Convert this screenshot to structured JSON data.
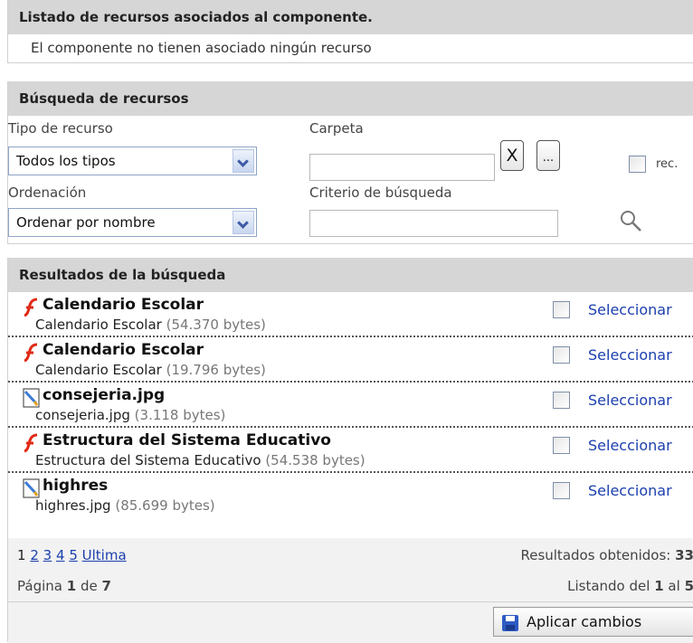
{
  "assoc": {
    "header": "Listado de recursos asociados al componente.",
    "empty_message": "El componente no tienen asociado ningún recurso"
  },
  "search": {
    "header": "Búsqueda de recursos",
    "type_label": "Tipo de recurso",
    "type_value": "Todos los tipos",
    "folder_label": "Carpeta",
    "folder_value": "",
    "clear_button": "X",
    "browse_button": "...",
    "rec_label": "rec.",
    "order_label": "Ordenación",
    "order_value": "Ordenar por nombre",
    "criteria_label": "Criterio de búsqueda",
    "criteria_value": ""
  },
  "results": {
    "header": "Resultados de la búsqueda",
    "select_label": "Seleccionar",
    "items": [
      {
        "title": "Calendario Escolar",
        "name": "Calendario Escolar",
        "size": "(54.370 bytes)",
        "icon": "flash-icon"
      },
      {
        "title": "Calendario Escolar",
        "name": "Calendario Escolar",
        "size": "(19.796 bytes)",
        "icon": "flash-icon"
      },
      {
        "title": "consejeria.jpg",
        "name": "consejeria.jpg",
        "size": "(3.118 bytes)",
        "icon": "image-icon"
      },
      {
        "title": "Estructura del Sistema Educativo",
        "name": "Estructura del Sistema Educativo",
        "size": "(54.538 bytes)",
        "icon": "flash-icon"
      },
      {
        "title": "highres",
        "name": "highres.jpg",
        "size": "(85.699 bytes)",
        "icon": "image-icon"
      }
    ]
  },
  "pager": {
    "current": "1",
    "pages": [
      "2",
      "3",
      "4",
      "5"
    ],
    "last": "Ultima",
    "results_label": "Resultados obtenidos:",
    "results_count": "33",
    "page_label": "Página",
    "page_current": "1",
    "page_of": "de",
    "page_total": "7",
    "listing_label": "Listando del",
    "listing_from": "1",
    "listing_al": "al",
    "listing_to": "5"
  },
  "apply_button": "Aplicar cambios",
  "colors": {
    "header_bg": "#d6d6d6",
    "link": "#1b3fae",
    "flash": "#e02a14"
  }
}
